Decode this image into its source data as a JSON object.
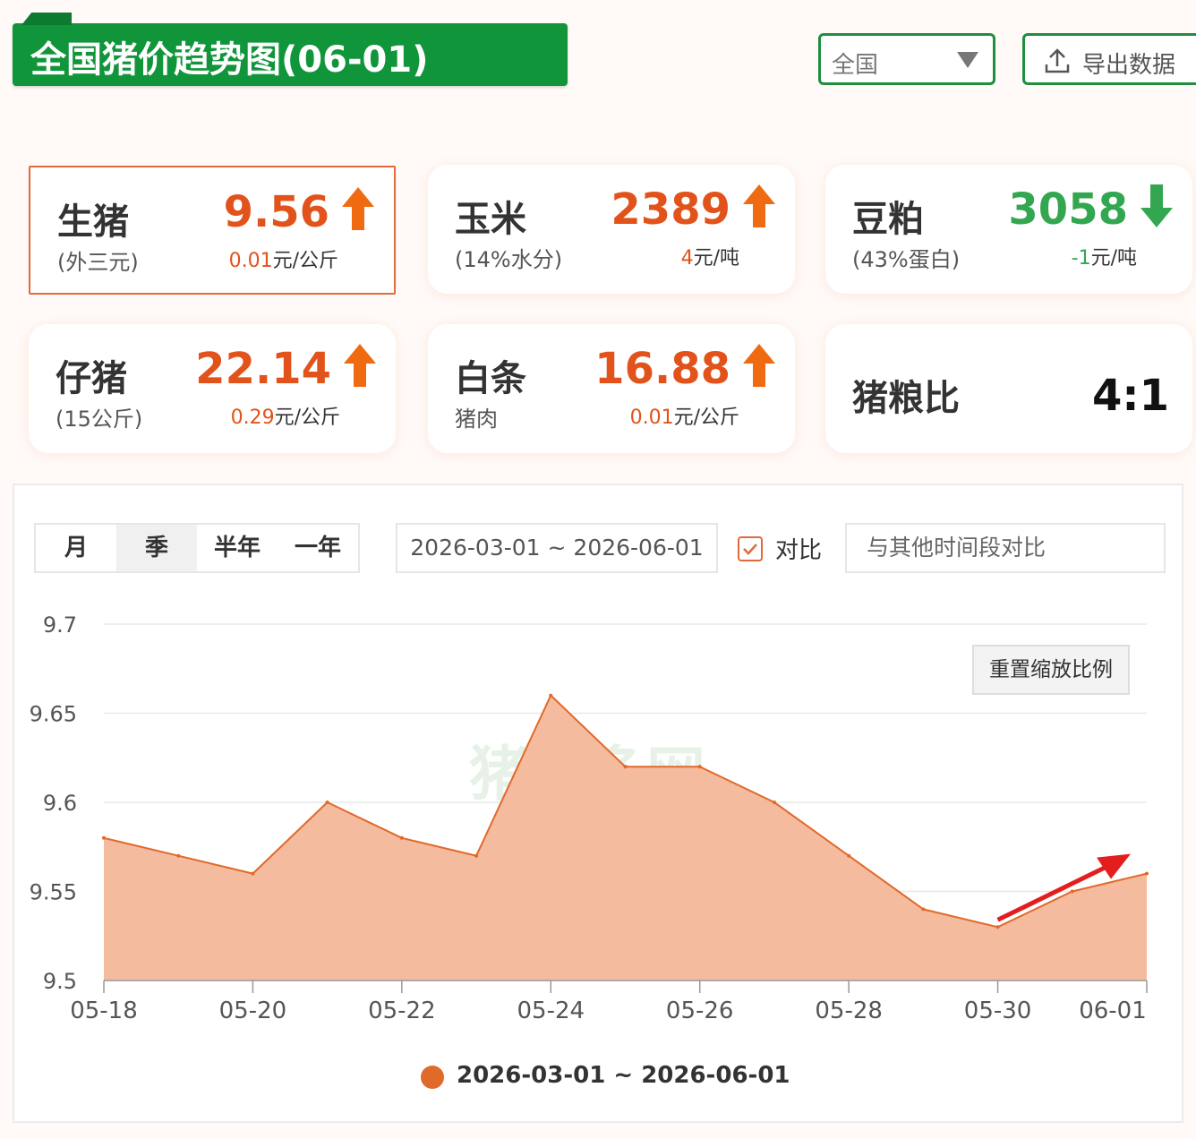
{
  "header": {
    "title": "全国猪价趋势图(06-01)",
    "region": "全国",
    "export_label": "导出数据"
  },
  "cards": [
    {
      "name": "生猪",
      "sub": "(外三元)",
      "price": "9.56",
      "change": "0.01",
      "unit": "元/公斤",
      "dir": "up"
    },
    {
      "name": "玉米",
      "sub": "(14%水分)",
      "price": "2389",
      "change": "4",
      "unit": "元/吨",
      "dir": "up"
    },
    {
      "name": "豆粕",
      "sub": "(43%蛋白)",
      "price": "3058",
      "change": "-1",
      "unit": "元/吨",
      "dir": "down"
    },
    {
      "name": "仔猪",
      "sub": "(15公斤)",
      "price": "22.14",
      "change": "0.29",
      "unit": "元/公斤",
      "dir": "up"
    },
    {
      "name": "白条",
      "sub": "猪肉",
      "price": "16.88",
      "change": "0.01",
      "unit": "元/公斤",
      "dir": "up"
    },
    {
      "name": "猪粮比",
      "ratio": "4:1"
    }
  ],
  "controls": {
    "ranges": [
      "月",
      "季",
      "半年",
      "一年"
    ],
    "active_range": "季",
    "date_range": "2026-03-01 ~ 2026-06-01",
    "compare_label": "对比",
    "compare_placeholder": "与其他时间段对比",
    "reset_label": "重置缩放比例"
  },
  "colors": {
    "accent": "#e2531b",
    "green": "#11953b",
    "down": "#33a650",
    "area": "#f4b79a",
    "line": "#e06a2a"
  },
  "chart_data": {
    "type": "area",
    "x": [
      "05-18",
      "05-19",
      "05-20",
      "05-21",
      "05-22",
      "05-23",
      "05-24",
      "05-25",
      "05-26",
      "05-27",
      "05-28",
      "05-29",
      "05-30",
      "05-31",
      "06-01"
    ],
    "x_ticks": [
      "05-18",
      "05-20",
      "05-22",
      "05-24",
      "05-26",
      "05-28",
      "05-30",
      "06-01"
    ],
    "series": [
      {
        "name": "2026-03-01 ~ 2026-06-01",
        "values": [
          9.58,
          9.57,
          9.56,
          9.6,
          9.58,
          9.57,
          9.66,
          9.62,
          9.62,
          9.6,
          9.57,
          9.54,
          9.53,
          9.55,
          9.56
        ]
      }
    ],
    "ylim": [
      9.5,
      9.7
    ],
    "y_ticks": [
      9.5,
      9.55,
      9.6,
      9.65,
      9.7
    ],
    "grid": true,
    "legend": "bottom",
    "annotation": "rising-arrow"
  }
}
